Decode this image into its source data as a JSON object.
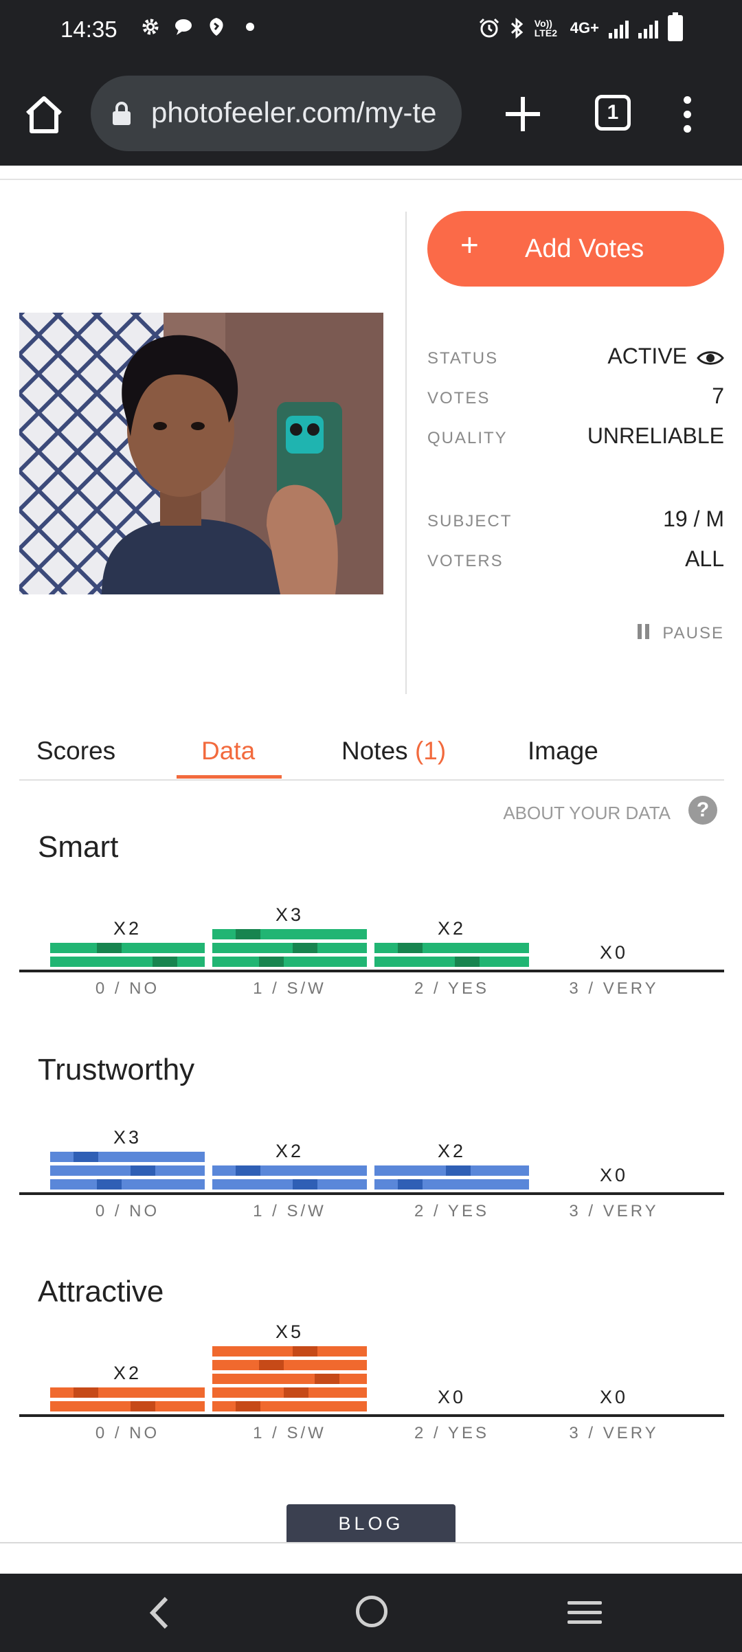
{
  "status_bar": {
    "time": "14:35",
    "network_label": "4G+",
    "volte_label": "Vo)) LTE2",
    "icons": [
      "gear-icon",
      "chat-bubble-icon",
      "shield-icon",
      "dot-icon",
      "alarm-icon",
      "bluetooth-icon",
      "signal-icon",
      "signal-icon",
      "battery-icon"
    ]
  },
  "browser": {
    "url": "photofeeler.com/my-te",
    "tab_count": "1",
    "icons": [
      "home-icon",
      "lock-icon",
      "plus-icon",
      "tabs-icon",
      "more-vert-icon"
    ]
  },
  "profile": {
    "add_votes_plus": "+",
    "add_votes_label": "Add Votes",
    "status_key": "STATUS",
    "status_value": "ACTIVE",
    "votes_key": "VOTES",
    "votes_value": "7",
    "quality_key": "QUALITY",
    "quality_value": "UNRELIABLE",
    "subject_key": "SUBJECT",
    "subject_value": "19 / M",
    "voters_key": "VOTERS",
    "voters_value": "ALL",
    "pause_label": "PAUSE"
  },
  "tabs": [
    {
      "label": "Scores",
      "count": ""
    },
    {
      "label": "Data",
      "count": ""
    },
    {
      "label": "Notes ",
      "count": "(1)"
    },
    {
      "label": "Image",
      "count": ""
    }
  ],
  "active_tab": "Data",
  "about_label": "ABOUT YOUR DATA",
  "help_glyph": "?",
  "colors": {
    "accent": "#f26a3d",
    "button": "#fb6a48",
    "smart": "#21b573",
    "smart_dark": "#17844f",
    "trustworthy": "#5a87d9",
    "trustworthy_dark": "#2f5fb5",
    "attractive": "#f0692e",
    "attractive_dark": "#c64a18"
  },
  "chart_data": [
    {
      "type": "bar",
      "title": "Smart",
      "categories": [
        "0 / NO",
        "1 / S/W",
        "2 / YES",
        "3 / VERY"
      ],
      "values": [
        2,
        3,
        2,
        0
      ],
      "count_labels": [
        "X2",
        "X3",
        "X2",
        "X0"
      ]
    },
    {
      "type": "bar",
      "title": "Trustworthy",
      "categories": [
        "0 / NO",
        "1 / S/W",
        "2 / YES",
        "3 / VERY"
      ],
      "values": [
        3,
        2,
        2,
        0
      ],
      "count_labels": [
        "X3",
        "X2",
        "X2",
        "X0"
      ]
    },
    {
      "type": "bar",
      "title": "Attractive",
      "categories": [
        "0 / NO",
        "1 / S/W",
        "2 / YES",
        "3 / VERY"
      ],
      "values": [
        2,
        5,
        0,
        0
      ],
      "count_labels": [
        "X2",
        "X5",
        "X0",
        "X0"
      ]
    }
  ],
  "blog_label": "BLOG",
  "nav": [
    "back-icon",
    "home-circle-icon",
    "recent-apps-icon"
  ]
}
